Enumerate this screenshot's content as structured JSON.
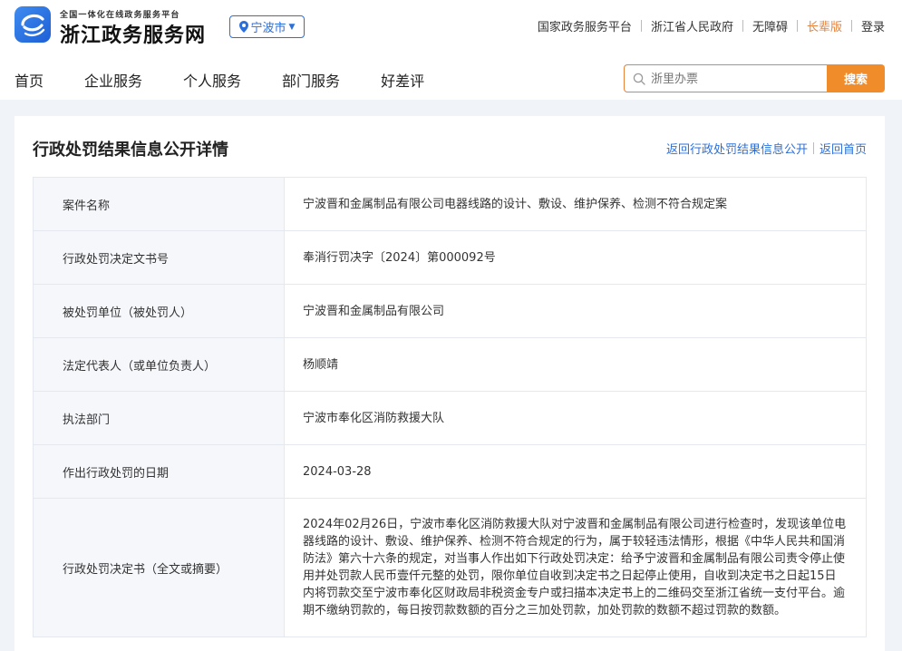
{
  "header": {
    "subtitle": "全国一体化在线政务服务平台",
    "title": "浙江政务服务网",
    "city": "宁波市",
    "top_links": [
      "国家政务服务平台",
      "浙江省人民政府",
      "无障碍",
      "长辈版",
      "登录"
    ]
  },
  "nav": {
    "items": [
      "首页",
      "企业服务",
      "个人服务",
      "部门服务",
      "好差评"
    ]
  },
  "search": {
    "placeholder": "浙里办票",
    "button": "搜索"
  },
  "card": {
    "title": "行政处罚结果信息公开详情",
    "link_back_list": "返回行政处罚结果信息公开",
    "link_home": "返回首页"
  },
  "details": [
    {
      "label": "案件名称",
      "value": "宁波晋和金属制品有限公司电器线路的设计、敷设、维护保养、检测不符合规定案"
    },
    {
      "label": "行政处罚决定文书号",
      "value": "奉消行罚决字〔2024〕第000092号"
    },
    {
      "label": "被处罚单位（被处罚人）",
      "value": "宁波晋和金属制品有限公司"
    },
    {
      "label": "法定代表人（或单位负责人）",
      "value": "杨顺靖"
    },
    {
      "label": "执法部门",
      "value": "宁波市奉化区消防救援大队"
    },
    {
      "label": "作出行政处罚的日期",
      "value": "2024-03-28"
    },
    {
      "label": "行政处罚决定书（全文或摘要）",
      "value": "2024年02月26日，宁波市奉化区消防救援大队对宁波晋和金属制品有限公司进行检查时，发现该单位电器线路的设计、敷设、维护保养、检测不符合规定的行为，属于较轻违法情形，根据《中华人民共和国消防法》第六十六条的规定，对当事人作出如下行政处罚决定：给予宁波晋和金属制品有限公司责令停止使用并处罚款人民币壹仟元整的处罚，限你单位自收到决定书之日起停止使用，自收到决定书之日起15日内将罚款交至宁波市奉化区财政局非税资金专户或扫描本决定书上的二维码交至浙江省统一支付平台。逾期不缴纳罚款的，每日按罚款数额的百分之三加处罚款，加处罚款的数额不超过罚款的数额。"
    }
  ],
  "colors": {
    "brand_blue": "#2c6fd9",
    "accent_orange": "#f18c2b",
    "elder_orange": "#e8823a"
  }
}
